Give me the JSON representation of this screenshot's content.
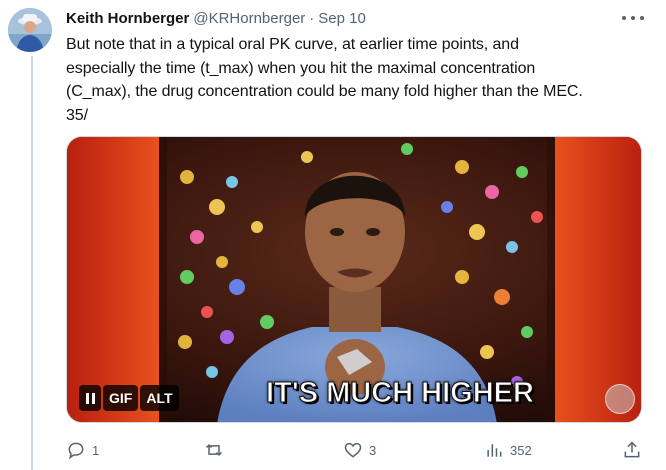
{
  "tweet": {
    "author_name": "Keith Hornberger",
    "handle": "@KRHornberger",
    "separator": "·",
    "date": "Sep 10",
    "text_lines": [
      "But note that in a typical oral PK curve, at earlier time points, and",
      "especially the time (t_max) when you hit the maximal concentration",
      "(C_max), the drug concentration could be many fold higher than the MEC.",
      "35/"
    ],
    "media": {
      "caption": "IT'S MUCH HIGHER",
      "badges": {
        "gif": "GIF",
        "alt": "ALT"
      }
    },
    "actions": {
      "replies": "1",
      "reposts": "",
      "likes": "3",
      "views": "352"
    }
  },
  "icons": {
    "more": "more-horizontal-icon",
    "reply": "reply-icon",
    "repost": "repost-icon",
    "like": "heart-icon",
    "views": "views-bar-chart-icon",
    "share": "share-icon",
    "pause": "pause-icon"
  },
  "colors": {
    "text_primary": "#0f1419",
    "text_secondary": "#536471",
    "border": "#cfd9de"
  }
}
